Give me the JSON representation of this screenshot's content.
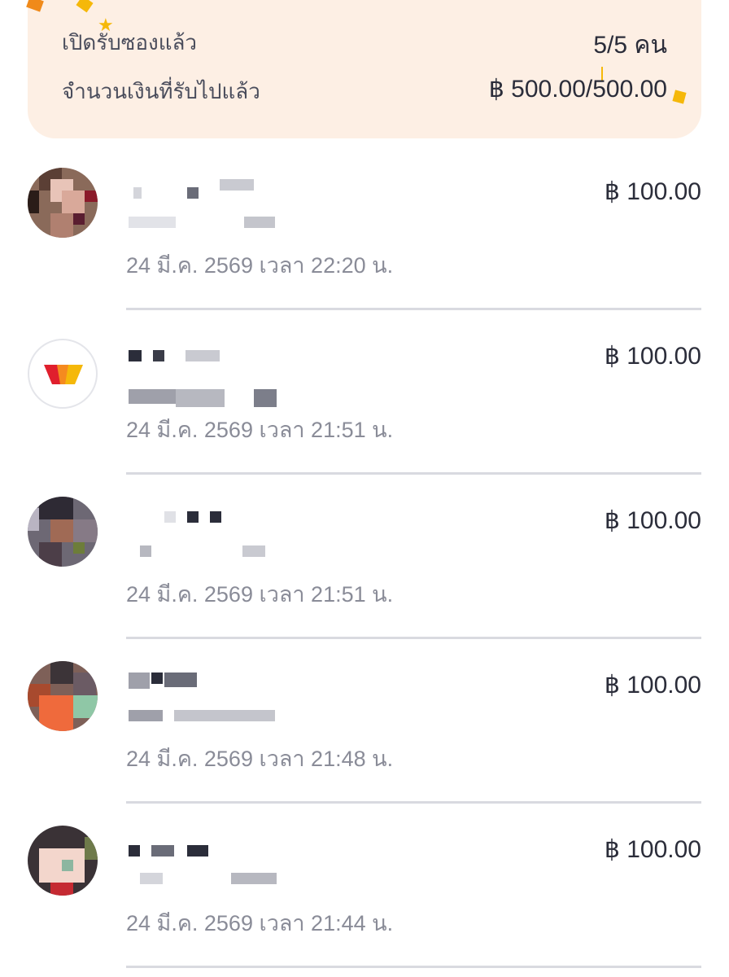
{
  "summary": {
    "opened_label": "เปิดรับซองแล้ว",
    "opened_value": "5/5 คน",
    "received_label": "จำนวนเงินที่รับไปแล้ว",
    "received_value": "฿ 500.00/500.00"
  },
  "colors": {
    "card_bg": "#fdefe4",
    "confetti": "#f5b80a",
    "text_primary": "#2b2d3a",
    "text_secondary": "#8a8c98"
  },
  "recipients": [
    {
      "time": "24 มี.ค. 2569 เวลา 22:20 น.",
      "amount": "฿ 100.00",
      "avatar": "pixelated-photo"
    },
    {
      "time": "24 มี.ค. 2569 เวลา 21:51 น.",
      "amount": "฿ 100.00",
      "avatar": "wallet-logo-icon"
    },
    {
      "time": "24 มี.ค. 2569 เวลา 21:51 น.",
      "amount": "฿ 100.00",
      "avatar": "pixelated-photo"
    },
    {
      "time": "24 มี.ค. 2569 เวลา 21:48 น.",
      "amount": "฿ 100.00",
      "avatar": "pixelated-photo"
    },
    {
      "time": "24 มี.ค. 2569 เวลา 21:44 น.",
      "amount": "฿ 100.00",
      "avatar": "pixelated-photo"
    }
  ]
}
